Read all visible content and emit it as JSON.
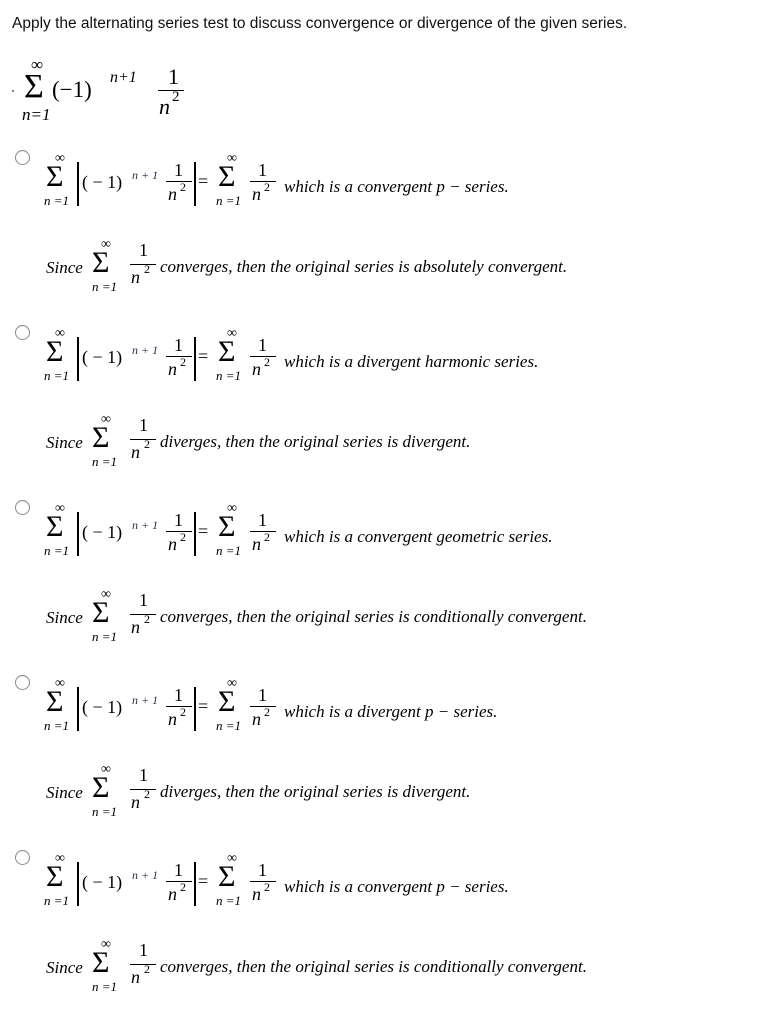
{
  "question": {
    "prompt": "Apply the alternating series test to discuss convergence or divergence of the given series.",
    "series": {
      "upper": "∞",
      "lower": "n=1",
      "term_base": "(−1)",
      "term_exponent": "n+1",
      "numerator": "1",
      "denominator": "n",
      "denominator_power": "2"
    }
  },
  "common": {
    "sigma": "Σ",
    "upper": "∞",
    "lower": "n =1",
    "lower_right": "n =1",
    "open_term": "( − 1)",
    "exponent": "n + 1",
    "numerator": "1",
    "denominator": "n",
    "power": "2",
    "equals": "=",
    "since": "Since"
  },
  "options": [
    {
      "first_line_tail": "which is a convergent p − series.",
      "second_line_tail": "converges, then the original series is absolutely convergent.",
      "selected": false
    },
    {
      "first_line_tail": "which is a divergent harmonic series.",
      "second_line_tail": "diverges, then the original series is divergent.",
      "selected": false
    },
    {
      "first_line_tail": "which is a convergent geometric series.",
      "second_line_tail": "converges, then the original series is conditionally convergent.",
      "selected": false
    },
    {
      "first_line_tail": "which is a divergent p − series.",
      "second_line_tail": "diverges, then the original series is divergent.",
      "selected": false
    },
    {
      "first_line_tail": "which is a convergent p − series.",
      "second_line_tail": "converges, then the original series is conditionally convergent.",
      "selected": false
    }
  ]
}
